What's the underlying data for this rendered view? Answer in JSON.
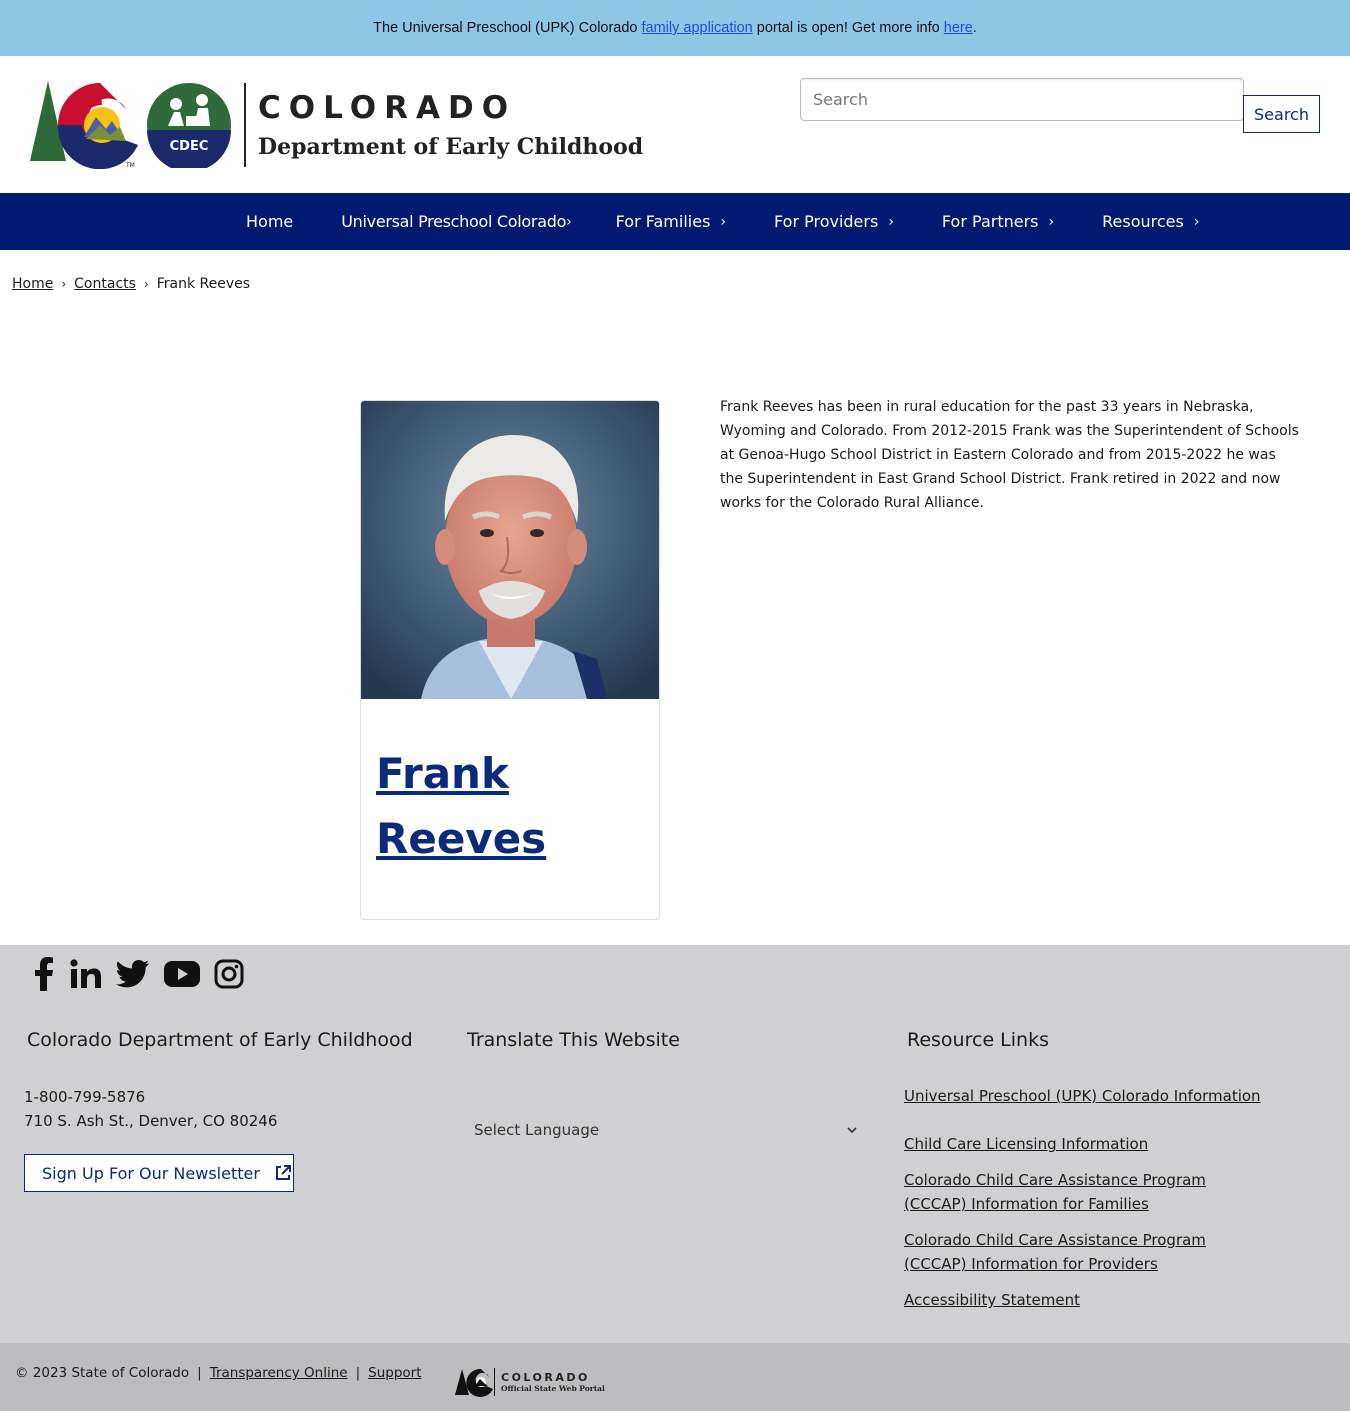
{
  "alert": {
    "prefix": "The Universal Preschool (UPK) Colorado ",
    "link1": "family application",
    "middle": " portal is open! Get more info ",
    "link2": "here",
    "suffix": "."
  },
  "header": {
    "logo_wordmark": "COLORADO",
    "logo_department": "Department of Early Childhood",
    "cdec_badge": "CDEC",
    "search_placeholder": "Search",
    "search_button": "Search"
  },
  "nav": {
    "items": [
      {
        "label": "Home",
        "has_submenu": false
      },
      {
        "label": "Universal Preschool Colorado",
        "has_submenu": true
      },
      {
        "label": "For Families",
        "has_submenu": true
      },
      {
        "label": "For Providers",
        "has_submenu": true
      },
      {
        "label": "For Partners",
        "has_submenu": true
      },
      {
        "label": "Resources",
        "has_submenu": true
      }
    ],
    "chevron_icon": "chevron-right-icon"
  },
  "breadcrumb": {
    "home": "Home",
    "contacts": "Contacts",
    "current": "Frank Reeves"
  },
  "contact": {
    "name": "Frank Reeves",
    "bio": "Frank Reeves has been in rural education for the past 33 years in Nebraska, Wyoming and Colorado. From 2012-2015 Frank was the Superintendent of Schools at Genoa-Hugo School District in Eastern Colorado and from 2015-2022 he was the Superintendent in East Grand School District. Frank retired in 2022 and now works for the Colorado Rural Alliance."
  },
  "footer": {
    "social_icons": [
      "facebook-icon",
      "linkedin-icon",
      "twitter-icon",
      "youtube-icon",
      "instagram-icon"
    ],
    "col1_title": "Colorado Department of Early Childhood",
    "phone": "1-800-799-5876",
    "address": "710 S. Ash St., Denver, CO 80246",
    "newsletter": "Sign Up For Our Newsletter",
    "col2_title": "Translate This Website",
    "language_select": "Select Language",
    "col3_title": "Resource Links",
    "resource_links": [
      "Universal Preschool (UPK) Colorado Information",
      "Child Care Licensing Information",
      "Colorado Child Care Assistance Program (CCCAP) Information for Families",
      "Colorado Child Care Assistance Program (CCCAP) Information for Providers",
      "Accessibility Statement"
    ]
  },
  "bottom": {
    "copyright": "© 2023 State of Colorado",
    "transparency": "Transparency Online",
    "support": "Support",
    "portal_wordmark": "COLORADO",
    "portal_sub": "Official State Web Portal"
  },
  "colors": {
    "alert_bg": "#8ec6e6",
    "nav_bg": "#001a72",
    "link_blue": "#0c2a7a",
    "footer_bg": "#d0d0d2",
    "bottom_bg": "#bdbdc0"
  }
}
